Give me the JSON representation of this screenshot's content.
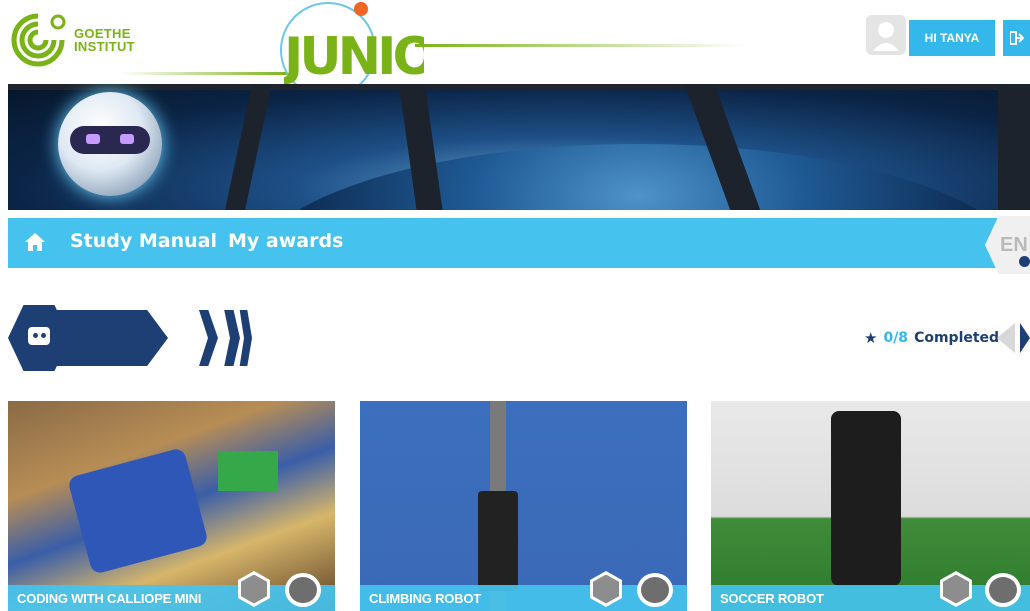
{
  "header": {
    "logo_line1": "GOETHE",
    "logo_line2": "INSTITUT",
    "brand": "JUNIOR",
    "greeting": "HI TANYA"
  },
  "nav": {
    "home_icon": "home-icon",
    "links": [
      "Study Manual",
      "My awards"
    ],
    "language": "EN"
  },
  "progress": {
    "completed_count": "0/8",
    "completed_label": "Completed"
  },
  "cards": [
    {
      "title": "CODING WITH CALLIOPE MINI"
    },
    {
      "title": "CLIMBING ROBOT"
    },
    {
      "title": "SOCCER ROBOT"
    }
  ],
  "colors": {
    "accent": "#45c3ee",
    "navy": "#1e3f73",
    "brand_green": "#7ab317",
    "orange": "#f26522"
  }
}
